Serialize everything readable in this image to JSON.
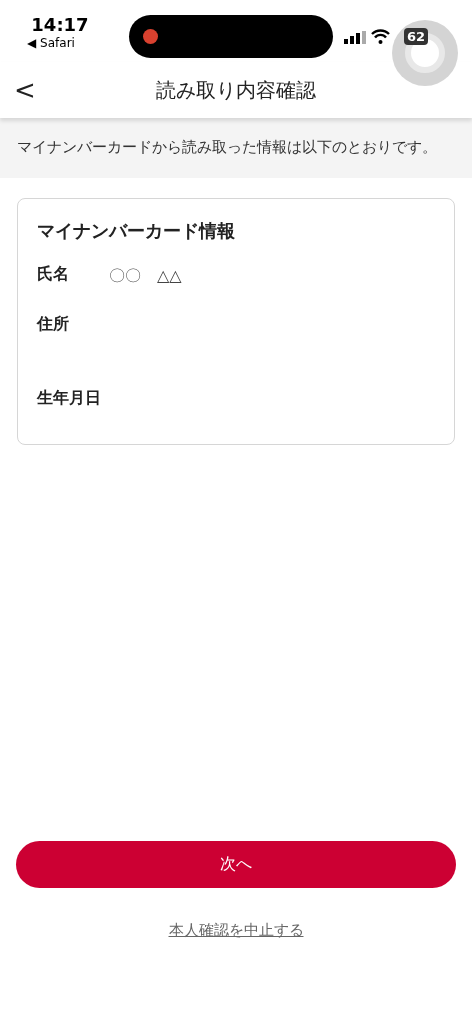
{
  "status_bar": {
    "time": "14:17",
    "back_app": "◀ Safari",
    "battery": "62"
  },
  "header": {
    "back": "<",
    "title": "読み取り内容確認"
  },
  "intro": "マイナンバーカードから読み取った情報は以下のとおりです。",
  "card": {
    "title": "マイナンバーカード情報",
    "fields": [
      {
        "label": "氏名",
        "value": "〇〇　△△"
      },
      {
        "label": "住所"
      },
      {
        "label": "生年月日"
      }
    ]
  },
  "buttons": {
    "primary": "次へ",
    "cancel_link": "本人確認を中止する"
  }
}
